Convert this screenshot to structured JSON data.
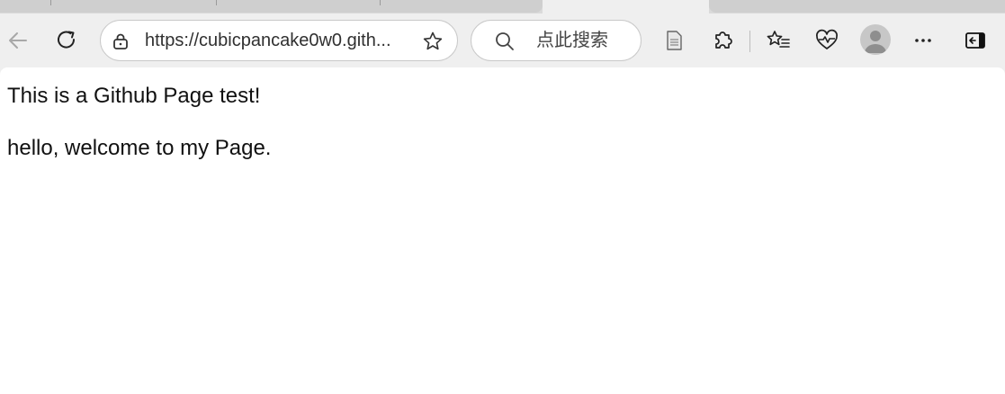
{
  "browser": {
    "address": {
      "url": "https://cubicpancake0w0.gith..."
    },
    "search": {
      "placeholder": "点此搜索"
    }
  },
  "page": {
    "paragraphs": [
      "This is a Github Page test!",
      "hello, welcome to my Page."
    ]
  },
  "colors": {
    "toolbar_bg": "#efefef",
    "tabstrip_bg": "#dadada",
    "page_bg": "#ffffff"
  }
}
